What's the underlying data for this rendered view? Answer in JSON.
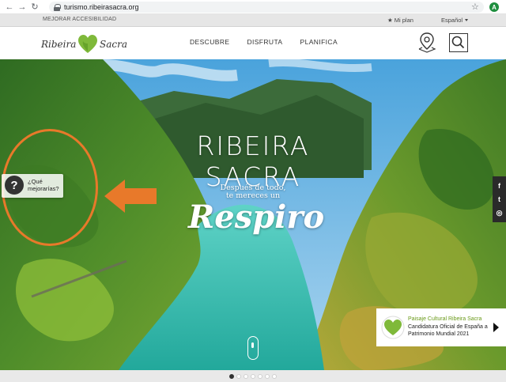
{
  "browser": {
    "url": "turismo.ribeirasacra.org",
    "profile_initial": "A"
  },
  "utility_bar": {
    "accessibility_link": "MEJORAR ACCESIBILIDAD",
    "my_plan": "Mi plan",
    "language": "Español"
  },
  "header": {
    "logo_left": "Ribeira",
    "logo_right": "Sacra",
    "nav": [
      "DESCUBRE",
      "DISFRUTA",
      "PLANIFICA"
    ]
  },
  "hero": {
    "title": "RIBEIRA SACRA",
    "subtitle_line1": "Después de todo,",
    "subtitle_line2": "te mereces un",
    "script": "Respiro"
  },
  "feedback": {
    "icon_char": "?",
    "line1": "¿Qué",
    "line2": "mejorarías?"
  },
  "social": {
    "icons": [
      "facebook-icon",
      "twitter-icon",
      "instagram-icon"
    ],
    "glyphs": [
      "f",
      "t",
      "◎"
    ]
  },
  "promo": {
    "title": "Paisaje Cultural Ribeira Sacra",
    "line1": "Candidatura Oficial de España a",
    "line2": "Patrimonio Mundial 2021"
  },
  "carousel": {
    "total": 7,
    "active_index": 0
  },
  "colors": {
    "annotation": "#e8792a",
    "brand_green": "#7fb93a",
    "river": "#2fc3b8"
  }
}
